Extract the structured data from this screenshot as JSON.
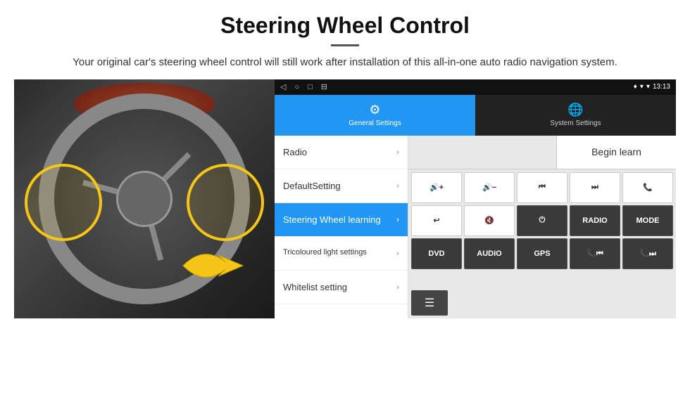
{
  "header": {
    "title": "Steering Wheel Control",
    "subtitle": "Your original car's steering wheel control will still work after installation of this all-in-one auto radio navigation system."
  },
  "android": {
    "status_bar": {
      "time": "13:13",
      "nav_back": "◁",
      "nav_home": "○",
      "nav_recent": "□",
      "nav_app": "⊟",
      "location_icon": "♦",
      "wifi_icon": "▾",
      "signal_icon": "▾"
    },
    "tabs": [
      {
        "label": "General Settings",
        "active": true
      },
      {
        "label": "System Settings",
        "active": false
      }
    ],
    "menu_items": [
      {
        "label": "Radio",
        "active": false
      },
      {
        "label": "DefaultSetting",
        "active": false
      },
      {
        "label": "Steering Wheel learning",
        "active": true
      },
      {
        "label": "Tricoloured light settings",
        "active": false
      },
      {
        "label": "Whitelist setting",
        "active": false
      }
    ],
    "begin_learn_label": "Begin learn",
    "control_buttons": {
      "row1": [
        "🔊+",
        "🔊−",
        "⏮",
        "⏭",
        "📞"
      ],
      "row2": [
        "↩",
        "🔊✕",
        "⏻",
        "RADIO",
        "MODE"
      ],
      "row3": [
        "DVD",
        "AUDIO",
        "GPS",
        "📞⏮",
        "📞⏭"
      ]
    }
  },
  "highlights": {
    "left_circle": true,
    "right_circle": true,
    "arrow": true
  }
}
